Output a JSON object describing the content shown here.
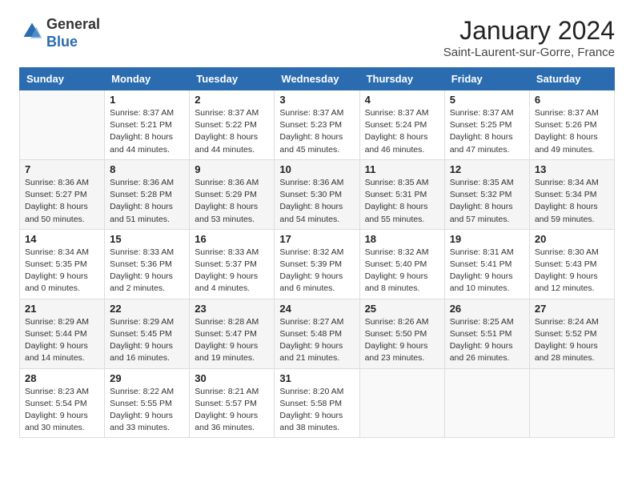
{
  "header": {
    "logo_general": "General",
    "logo_blue": "Blue",
    "month": "January 2024",
    "location": "Saint-Laurent-sur-Gorre, France"
  },
  "weekdays": [
    "Sunday",
    "Monday",
    "Tuesday",
    "Wednesday",
    "Thursday",
    "Friday",
    "Saturday"
  ],
  "weeks": [
    [
      {
        "day": "",
        "info": ""
      },
      {
        "day": "1",
        "info": "Sunrise: 8:37 AM\nSunset: 5:21 PM\nDaylight: 8 hours\nand 44 minutes."
      },
      {
        "day": "2",
        "info": "Sunrise: 8:37 AM\nSunset: 5:22 PM\nDaylight: 8 hours\nand 44 minutes."
      },
      {
        "day": "3",
        "info": "Sunrise: 8:37 AM\nSunset: 5:23 PM\nDaylight: 8 hours\nand 45 minutes."
      },
      {
        "day": "4",
        "info": "Sunrise: 8:37 AM\nSunset: 5:24 PM\nDaylight: 8 hours\nand 46 minutes."
      },
      {
        "day": "5",
        "info": "Sunrise: 8:37 AM\nSunset: 5:25 PM\nDaylight: 8 hours\nand 47 minutes."
      },
      {
        "day": "6",
        "info": "Sunrise: 8:37 AM\nSunset: 5:26 PM\nDaylight: 8 hours\nand 49 minutes."
      }
    ],
    [
      {
        "day": "7",
        "info": ""
      },
      {
        "day": "8",
        "info": "Sunrise: 8:36 AM\nSunset: 5:28 PM\nDaylight: 8 hours\nand 51 minutes."
      },
      {
        "day": "9",
        "info": "Sunrise: 8:36 AM\nSunset: 5:29 PM\nDaylight: 8 hours\nand 53 minutes."
      },
      {
        "day": "10",
        "info": "Sunrise: 8:36 AM\nSunset: 5:30 PM\nDaylight: 8 hours\nand 54 minutes."
      },
      {
        "day": "11",
        "info": "Sunrise: 8:35 AM\nSunset: 5:31 PM\nDaylight: 8 hours\nand 55 minutes."
      },
      {
        "day": "12",
        "info": "Sunrise: 8:35 AM\nSunset: 5:32 PM\nDaylight: 8 hours\nand 57 minutes."
      },
      {
        "day": "13",
        "info": "Sunrise: 8:34 AM\nSunset: 5:34 PM\nDaylight: 8 hours\nand 59 minutes."
      }
    ],
    [
      {
        "day": "14",
        "info": ""
      },
      {
        "day": "15",
        "info": "Sunrise: 8:33 AM\nSunset: 5:36 PM\nDaylight: 9 hours\nand 2 minutes."
      },
      {
        "day": "16",
        "info": "Sunrise: 8:33 AM\nSunset: 5:37 PM\nDaylight: 9 hours\nand 4 minutes."
      },
      {
        "day": "17",
        "info": "Sunrise: 8:32 AM\nSunset: 5:39 PM\nDaylight: 9 hours\nand 6 minutes."
      },
      {
        "day": "18",
        "info": "Sunrise: 8:32 AM\nSunset: 5:40 PM\nDaylight: 9 hours\nand 8 minutes."
      },
      {
        "day": "19",
        "info": "Sunrise: 8:31 AM\nSunset: 5:41 PM\nDaylight: 9 hours\nand 10 minutes."
      },
      {
        "day": "20",
        "info": "Sunrise: 8:30 AM\nSunset: 5:43 PM\nDaylight: 9 hours\nand 12 minutes."
      }
    ],
    [
      {
        "day": "21",
        "info": ""
      },
      {
        "day": "22",
        "info": "Sunrise: 8:29 AM\nSunset: 5:45 PM\nDaylight: 9 hours\nand 16 minutes."
      },
      {
        "day": "23",
        "info": "Sunrise: 8:28 AM\nSunset: 5:47 PM\nDaylight: 9 hours\nand 19 minutes."
      },
      {
        "day": "24",
        "info": "Sunrise: 8:27 AM\nSunset: 5:48 PM\nDaylight: 9 hours\nand 21 minutes."
      },
      {
        "day": "25",
        "info": "Sunrise: 8:26 AM\nSunset: 5:50 PM\nDaylight: 9 hours\nand 23 minutes."
      },
      {
        "day": "26",
        "info": "Sunrise: 8:25 AM\nSunset: 5:51 PM\nDaylight: 9 hours\nand 26 minutes."
      },
      {
        "day": "27",
        "info": "Sunrise: 8:24 AM\nSunset: 5:52 PM\nDaylight: 9 hours\nand 28 minutes."
      }
    ],
    [
      {
        "day": "28",
        "info": ""
      },
      {
        "day": "29",
        "info": "Sunrise: 8:22 AM\nSunset: 5:55 PM\nDaylight: 9 hours\nand 33 minutes."
      },
      {
        "day": "30",
        "info": "Sunrise: 8:21 AM\nSunset: 5:57 PM\nDaylight: 9 hours\nand 36 minutes."
      },
      {
        "day": "31",
        "info": "Sunrise: 8:20 AM\nSunset: 5:58 PM\nDaylight: 9 hours\nand 38 minutes."
      },
      {
        "day": "",
        "info": ""
      },
      {
        "day": "",
        "info": ""
      },
      {
        "day": "",
        "info": ""
      }
    ]
  ],
  "week1_sunday_info": "Sunrise: 8:36 AM\nSunset: 5:27 PM\nDaylight: 8 hours\nand 50 minutes.",
  "week3_sunday_info": "Sunrise: 8:34 AM\nSunset: 5:35 PM\nDaylight: 9 hours\nand 0 minutes.",
  "week4_sunday_info": "Sunrise: 8:29 AM\nSunset: 5:44 PM\nDaylight: 9 hours\nand 14 minutes.",
  "week5_sunday_info": "Sunrise: 8:23 AM\nSunset: 5:54 PM\nDaylight: 9 hours\nand 30 minutes."
}
